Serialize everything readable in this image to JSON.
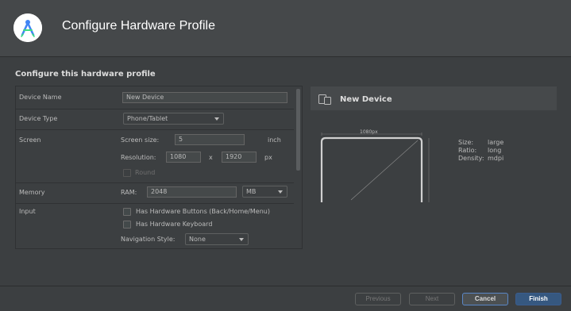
{
  "header": {
    "title": "Configure Hardware Profile",
    "logo_icon": "android-studio-logo-icon"
  },
  "section_title": "Configure this hardware profile",
  "form": {
    "device_name": {
      "label": "Device Name",
      "value": "New Device"
    },
    "device_type": {
      "label": "Device Type",
      "value": "Phone/Tablet"
    },
    "screen": {
      "label": "Screen",
      "size_label": "Screen size:",
      "size_value": "5",
      "size_unit": "inch",
      "resolution_label": "Resolution:",
      "res_w": "1080",
      "res_x": "x",
      "res_h": "1920",
      "res_unit": "px",
      "round_label": "Round"
    },
    "memory": {
      "label": "Memory",
      "ram_label": "RAM:",
      "ram_value": "2048",
      "ram_unit": "MB"
    },
    "input": {
      "label": "Input",
      "hw_buttons": "Has Hardware Buttons (Back/Home/Menu)",
      "hw_keyboard": "Has Hardware Keyboard",
      "nav_label": "Navigation Style:",
      "nav_value": "None"
    }
  },
  "preview": {
    "title": "New Device",
    "icon": "devices-icon",
    "width_label": "1080px",
    "specs": [
      {
        "key": "Size:",
        "value": "large"
      },
      {
        "key": "Ratio:",
        "value": "long"
      },
      {
        "key": "Density:",
        "value": "mdpi"
      }
    ]
  },
  "footer": {
    "previous": "Previous",
    "next": "Next",
    "cancel": "Cancel",
    "finish": "Finish"
  },
  "colors": {
    "background": "#3c3f41",
    "header": "#45484a",
    "accent": "#365880",
    "focus": "#5a87c7"
  }
}
